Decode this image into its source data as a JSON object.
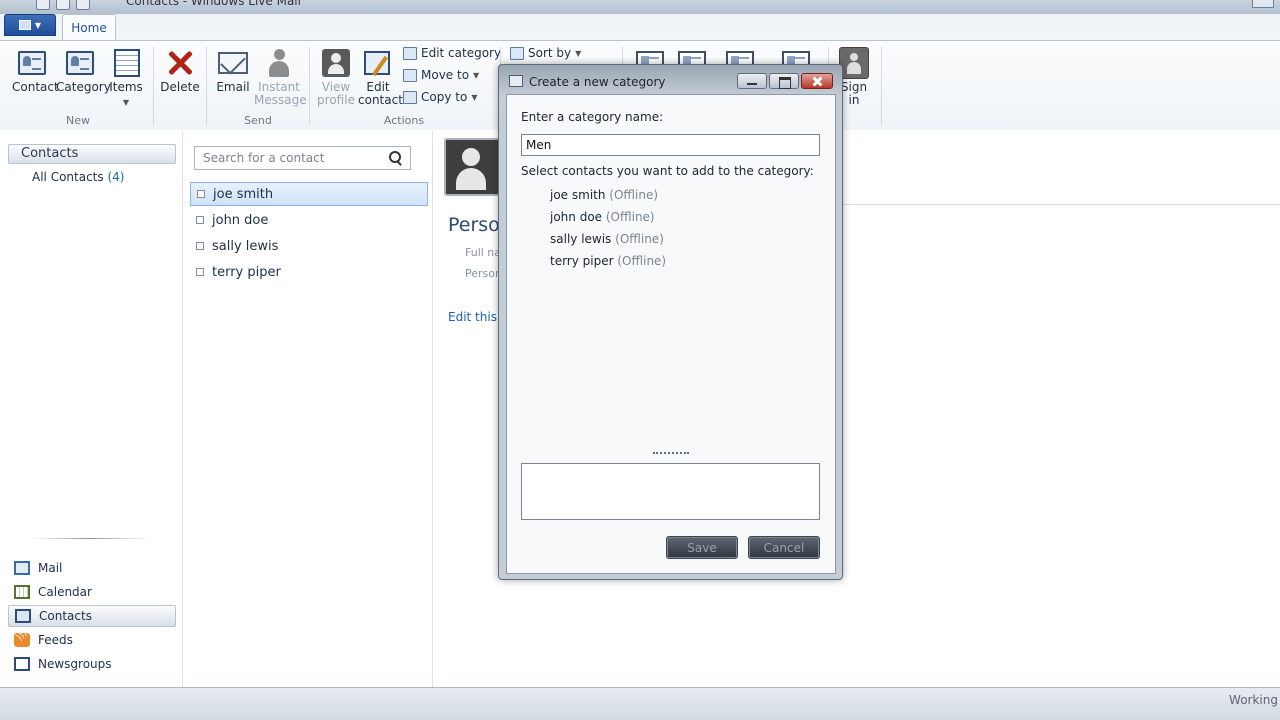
{
  "window": {
    "title": "Contacts - Windows Live Mail"
  },
  "ribbon": {
    "tab_home": "Home",
    "groups": {
      "new": "New",
      "send": "Send",
      "actions": "Actions"
    },
    "buttons": {
      "contact": "Contact",
      "category": "Category",
      "items": "Items",
      "delete": "Delete",
      "email": "Email",
      "instant_message_1": "Instant",
      "instant_message_2": "Message",
      "view_profile_1": "View",
      "view_profile_2": "profile",
      "edit_contact_1": "Edit",
      "edit_contact_2": "contact",
      "edit_category": "Edit category",
      "move_to": "Move to",
      "copy_to": "Copy to",
      "sort_by": "Sort by",
      "sign_in_1": "Sign",
      "sign_in_2": "in"
    }
  },
  "leftnav": {
    "header": "Contacts",
    "all_contacts": "All Contacts",
    "all_contacts_count": "(4)",
    "items": [
      {
        "label": "Mail",
        "icon": "mail-icon"
      },
      {
        "label": "Calendar",
        "icon": "calendar-icon"
      },
      {
        "label": "Contacts",
        "icon": "contacts-icon"
      },
      {
        "label": "Feeds",
        "icon": "feeds-icon"
      },
      {
        "label": "Newsgroups",
        "icon": "newsgroups-icon"
      }
    ]
  },
  "search": {
    "placeholder": "Search for a contact"
  },
  "contacts": [
    {
      "name": "joe smith"
    },
    {
      "name": "john doe"
    },
    {
      "name": "sally lewis"
    },
    {
      "name": "terry piper"
    }
  ],
  "details": {
    "heading": "Perso",
    "full_name_label": "Full na",
    "personal_label": "Person",
    "edit_link": "Edit this c"
  },
  "dialog": {
    "title": "Create a new category",
    "name_label": "Enter a category name:",
    "name_value": "Men",
    "select_label": "Select contacts you want to add to the category:",
    "contacts": [
      {
        "name": "joe smith",
        "status": "(Offline)"
      },
      {
        "name": "john doe",
        "status": "(Offline)"
      },
      {
        "name": "sally lewis",
        "status": "(Offline)"
      },
      {
        "name": "terry piper",
        "status": "(Offline)"
      }
    ],
    "save": "Save",
    "cancel": "Cancel"
  },
  "statusbar": {
    "text": "Working"
  },
  "colors": {
    "accent": "#1f4f9c",
    "link": "#1d63b8",
    "selection": "#cfe2f8"
  }
}
